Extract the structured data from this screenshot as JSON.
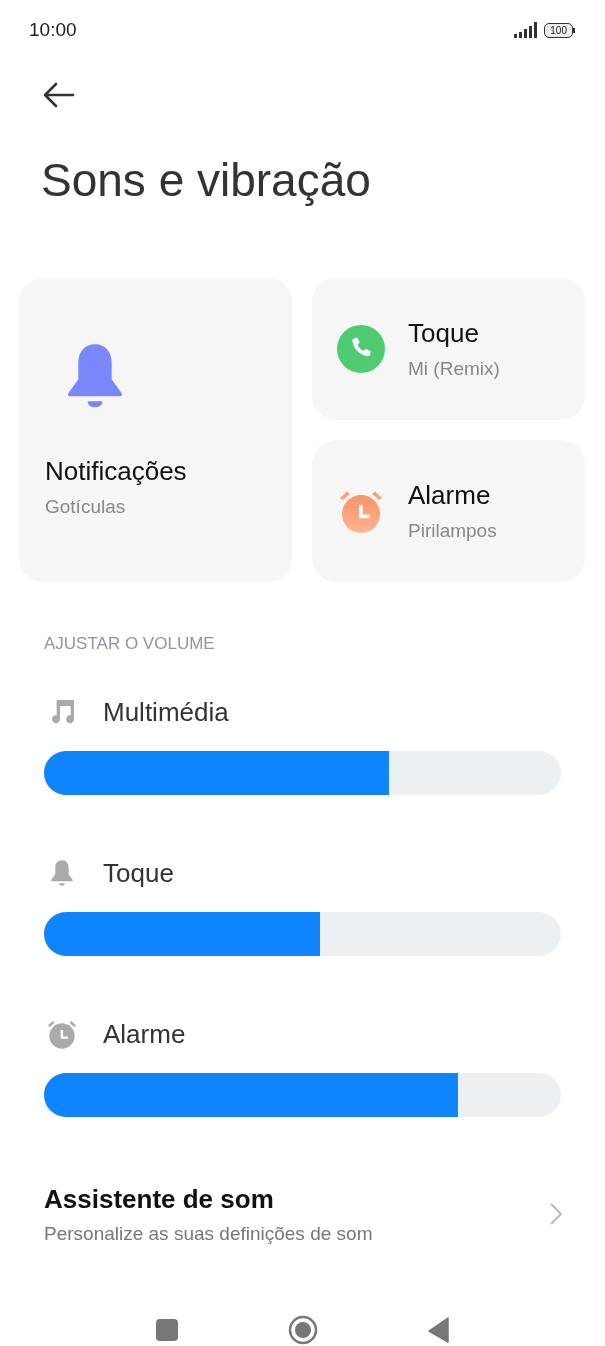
{
  "status_bar": {
    "time": "10:00",
    "battery": "100"
  },
  "title": "Sons e vibração",
  "cards": [
    {
      "kind": "bell",
      "title": "Notificações",
      "subtitle": "Gotículas"
    },
    {
      "kind": "phone",
      "title": "Toque",
      "subtitle": "Mi (Remix)"
    },
    {
      "kind": "alarm",
      "title": "Alarme",
      "subtitle": "Pirilampos"
    }
  ],
  "volume_section": {
    "header": "AJUSTAR O VOLUME",
    "sliders": [
      {
        "kind": "music",
        "label": "Multimédia",
        "level": 0.667
      },
      {
        "kind": "bell",
        "label": "Toque",
        "level": 0.533
      },
      {
        "kind": "alarm",
        "label": "Alarme",
        "level": 0.8
      }
    ]
  },
  "assistant": {
    "title": "Assistente de som",
    "subtitle": "Personalize as suas definições de som"
  }
}
